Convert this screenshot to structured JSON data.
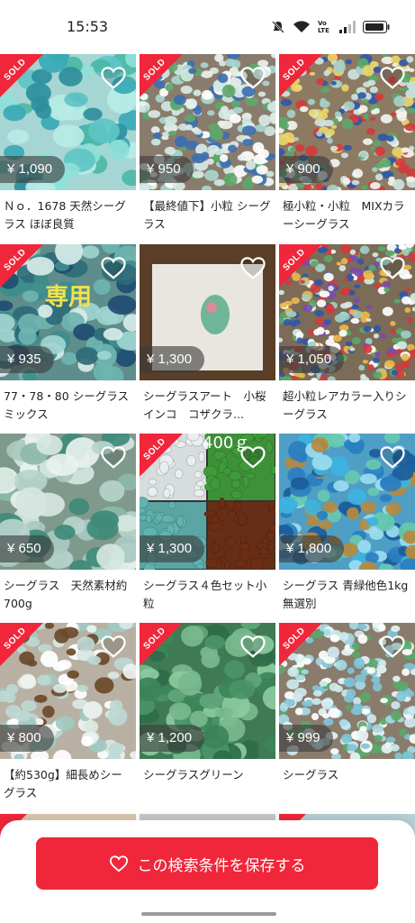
{
  "status_bar": {
    "time": "15:53",
    "network_label": "Vo LTE"
  },
  "products": [
    {
      "title": "Ｎｏ．1678 天然シーグラス ほぼ良質",
      "price": "¥ 1,090",
      "sold": true,
      "sold_label": "SOLD",
      "palette": "aqua-large"
    },
    {
      "title": "【最終値下】小粒 シーグラス",
      "price": "¥ 950",
      "sold": true,
      "sold_label": "SOLD",
      "palette": "white-small"
    },
    {
      "title": "極小粒・小粒　MIXカラーシーグラス",
      "price": "¥ 900",
      "sold": true,
      "sold_label": "SOLD",
      "palette": "mix-small"
    },
    {
      "title": "77・78・80 シーグラスミックス",
      "price": "¥ 935",
      "sold": true,
      "sold_label": "SOLD",
      "palette": "teal-mixed",
      "overlay": "専用"
    },
    {
      "title": "シーグラスアート　小桜インコ　コザクラ...",
      "price": "¥ 1,300",
      "sold": false,
      "palette": "frame-art"
    },
    {
      "title": "超小粒レアカラー入りシーグラス",
      "price": "¥ 1,050",
      "sold": true,
      "sold_label": "SOLD",
      "palette": "mix-rare"
    },
    {
      "title": "シーグラス　天然素材約700g",
      "price": "¥ 650",
      "sold": false,
      "palette": "frosted-large"
    },
    {
      "title": "シーグラス４色セット小粒",
      "price": "¥ 1,300",
      "sold": true,
      "sold_label": "SOLD",
      "palette": "four-color",
      "overlay": "400ｇ"
    },
    {
      "title": "シーグラス 青緑他色1kg 無選別",
      "price": "¥ 1,800",
      "sold": false,
      "palette": "blue-green"
    },
    {
      "title": "【約530g】細長めシーグラス",
      "price": "¥ 800",
      "sold": true,
      "sold_label": "SOLD",
      "palette": "white-long"
    },
    {
      "title": "シーグラスグリーン",
      "price": "¥ 1,200",
      "sold": true,
      "sold_label": "SOLD",
      "palette": "green"
    },
    {
      "title": "シーグラス",
      "price": "¥ 999",
      "sold": true,
      "sold_label": "SOLD",
      "palette": "aqua-small"
    }
  ],
  "bottom_bar": {
    "save_label": "この検索条件を保存する"
  },
  "icons": {
    "like": "heart-outline-icon",
    "save": "heart-outline-icon"
  },
  "colors": {
    "accent": "#f0263a",
    "price_bg": "#3c3c3c"
  }
}
